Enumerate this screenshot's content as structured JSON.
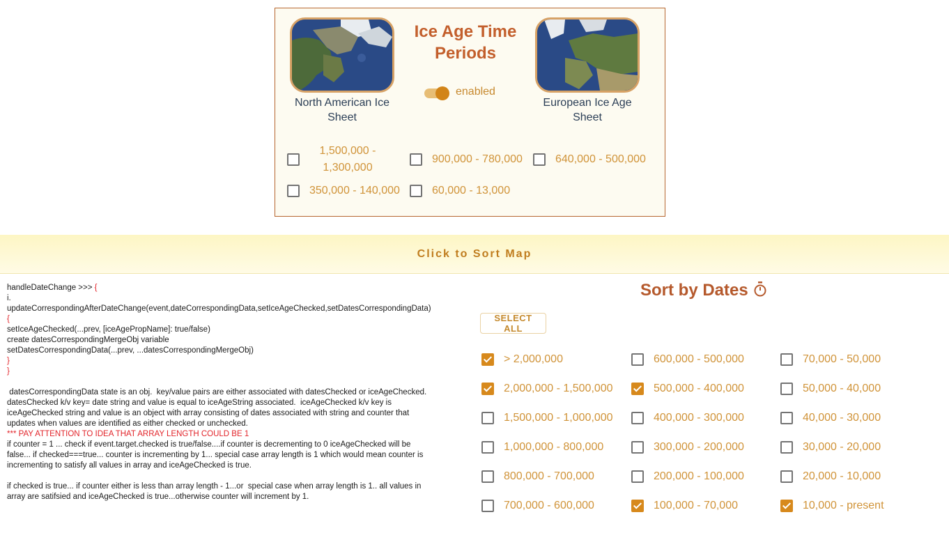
{
  "ice_panel": {
    "title": "Ice Age Time Periods",
    "north_american": {
      "label": "North American Ice Sheet"
    },
    "european": {
      "label": "European Ice Age Sheet"
    },
    "toggle": {
      "label": "enabled",
      "on": true
    },
    "options": [
      {
        "label": "1,500,000 - 1,300,000",
        "checked": false
      },
      {
        "label": "900,000 - 780,000",
        "checked": false
      },
      {
        "label": "640,000 - 500,000",
        "checked": false
      },
      {
        "label": "350,000 - 140,000",
        "checked": false
      },
      {
        "label": "60,000 - 13,000",
        "checked": false
      }
    ]
  },
  "banner": {
    "label": "Click to Sort Map"
  },
  "notes": {
    "lines": [
      {
        "text": "handleDateChange >>> ",
        "red": "{"
      },
      {
        "text": "i."
      },
      {
        "text": "updateCorrespondingAfterDateChange(event,dateCorrespondingData,setIceAgeChecked,setDatesCorrespondingData)"
      },
      {
        "red": "{"
      },
      {
        "text": "setIceAgeChecked(...prev, [iceAgePropName]: true/false)"
      },
      {
        "text": "create datesCorrespondingMergeObj variable"
      },
      {
        "text": "setDatesCorrespondingData(...prev, ...datesCorrespondingMergeObj)"
      },
      {
        "red": "}"
      },
      {
        "red": "}"
      },
      {
        "text": ""
      },
      {
        "text": " datesCorrespondingData state is an obj.  key/value pairs are either associated with datesChecked or iceAgeChecked."
      },
      {
        "text": "datesChecked k/v key= date string and value is equal to iceAgeString associated.  iceAgeChecked k/v key is"
      },
      {
        "text": "iceAgeChecked string and value is an object with array consisting of dates associated with string and counter that"
      },
      {
        "text": "updates when values are identified as either checked or unchecked."
      },
      {
        "red": "*** PAY ATTENTION TO IDEA THAT ARRAY LENGTH COULD BE 1"
      },
      {
        "text": "if counter = 1 ... check if event.target.checked is true/false....if counter is decrementing to 0 iceAgeChecked will be"
      },
      {
        "text": "false... if checked===true... counter is incrementing by 1... special case array length is 1 which would mean counter is"
      },
      {
        "text": "incrementing to satisfy all values in array and iceAgeChecked is true."
      },
      {
        "text": ""
      },
      {
        "text": "if checked is true... if counter either is less than array length - 1...or  special case when array length is 1.. all values in"
      },
      {
        "text": "array are satifsied and iceAgeChecked is true...otherwise counter will increment by 1."
      }
    ]
  },
  "sort": {
    "title": "Sort by Dates",
    "icon": "stopwatch-icon",
    "select_all": "SELECT ALL",
    "columns": [
      [
        {
          "label": "> 2,000,000",
          "checked": true
        },
        {
          "label": "2,000,000 - 1,500,000",
          "checked": true
        },
        {
          "label": "1,500,000 - 1,000,000",
          "checked": false
        },
        {
          "label": "1,000,000 - 800,000",
          "checked": false
        },
        {
          "label": "800,000 - 700,000",
          "checked": false
        },
        {
          "label": "700,000 - 600,000",
          "checked": false
        }
      ],
      [
        {
          "label": "600,000 - 500,000",
          "checked": false
        },
        {
          "label": "500,000 - 400,000",
          "checked": true
        },
        {
          "label": "400,000 - 300,000",
          "checked": false
        },
        {
          "label": "300,000 - 200,000",
          "checked": false
        },
        {
          "label": "200,000 - 100,000",
          "checked": false
        },
        {
          "label": "100,000 - 70,000",
          "checked": true
        }
      ],
      [
        {
          "label": "70,000 - 50,000",
          "checked": false
        },
        {
          "label": "50,000 - 40,000",
          "checked": false
        },
        {
          "label": "40,000 - 30,000",
          "checked": false
        },
        {
          "label": "30,000 - 20,000",
          "checked": false
        },
        {
          "label": "20,000 - 10,000",
          "checked": false
        },
        {
          "label": "10,000 - present",
          "checked": true
        }
      ]
    ]
  },
  "colors": {
    "accent": "#d7891c",
    "title": "#c35f2c",
    "label": "#d09338",
    "panel_border": "#b5652e"
  }
}
